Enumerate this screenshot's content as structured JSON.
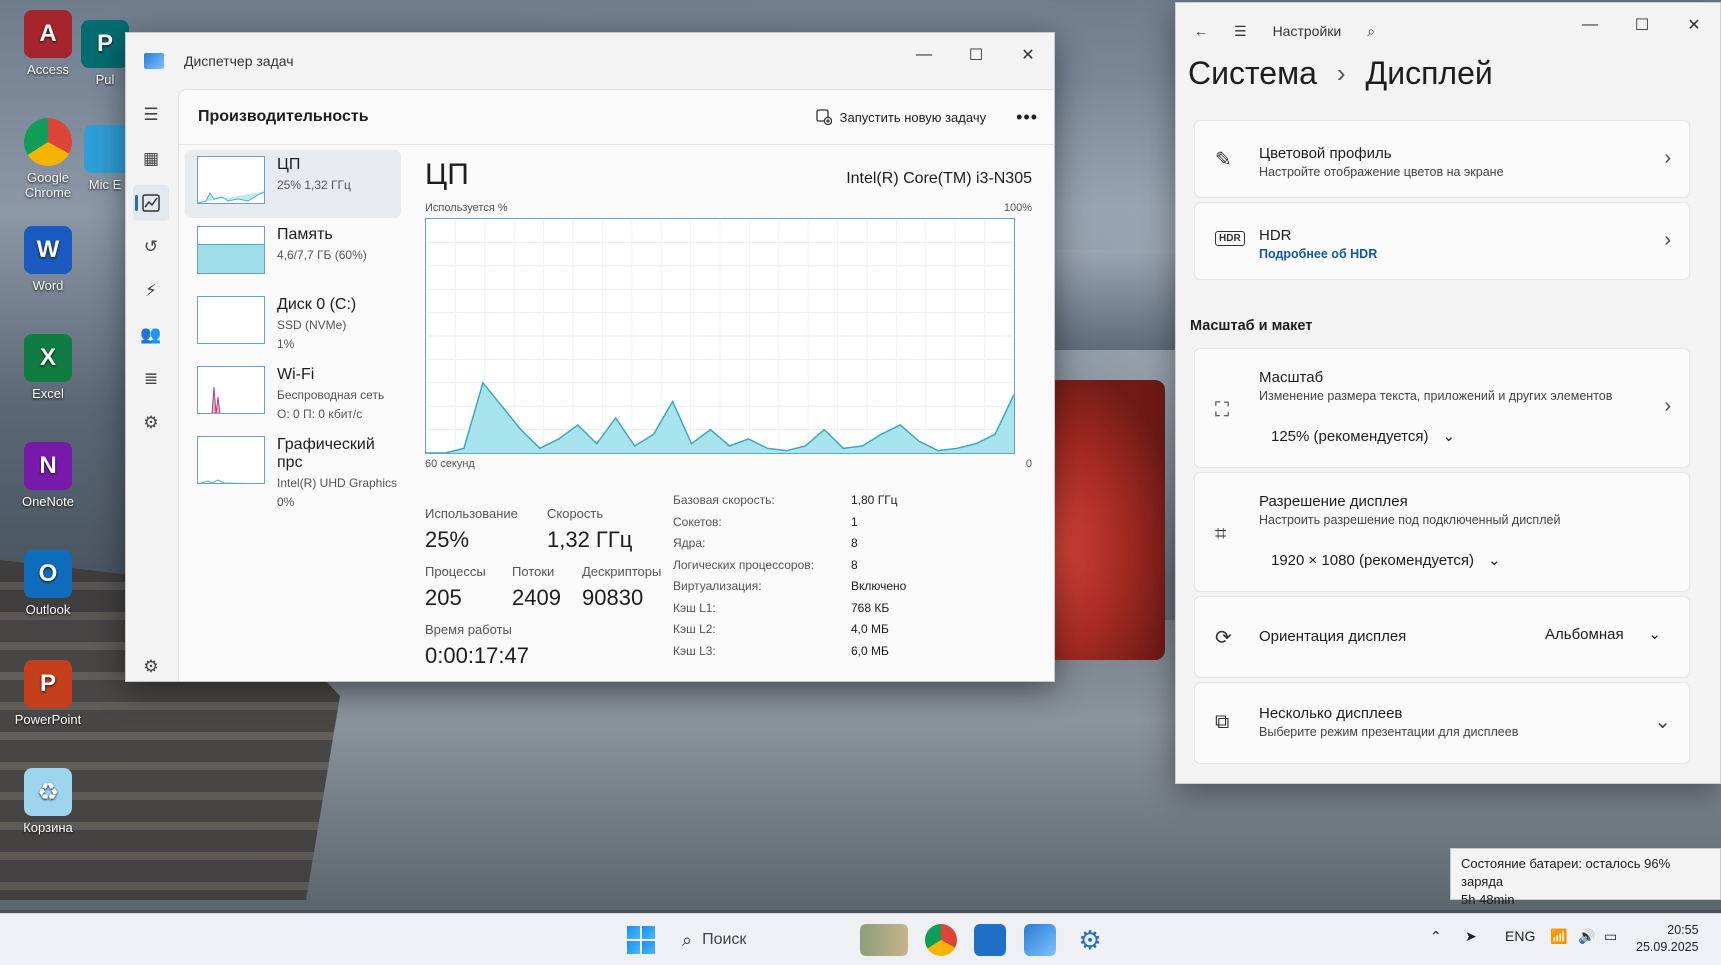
{
  "desktop": {
    "icons": [
      {
        "label": "Access",
        "letter": "A",
        "color": "#a4262c"
      },
      {
        "label": "Google Chrome",
        "letter": "",
        "color": "#ffffff"
      },
      {
        "label": "Word",
        "letter": "W",
        "color": "#185abd"
      },
      {
        "label": "Excel",
        "letter": "X",
        "color": "#107c41"
      },
      {
        "label": "OneNote",
        "letter": "N",
        "color": "#7719aa"
      },
      {
        "label": "Outlook",
        "letter": "O",
        "color": "#0f6cbd"
      },
      {
        "label": "PowerPoint",
        "letter": "P",
        "color": "#c43e1c"
      },
      {
        "label": "Корзина",
        "letter": "♻",
        "color": "#9fd4ef"
      }
    ],
    "partial_icons": [
      {
        "label": "Pul",
        "letter": "P",
        "color": "#036c70"
      },
      {
        "label": "Mic E",
        "letter": "",
        "color": "#2f9fd8"
      }
    ]
  },
  "task_manager": {
    "window_title": "Диспетчер задач",
    "page_title": "Производительность",
    "run_task_label": "Запустить новую задачу",
    "more_label": "•••",
    "perf_items": [
      {
        "name": "ЦП",
        "sub1": "25%  1,32 ГГц",
        "sub2": "",
        "sub3": ""
      },
      {
        "name": "Память",
        "sub1": "4,6/7,7 ГБ (60%)",
        "sub2": "",
        "sub3": ""
      },
      {
        "name": "Диск 0 (C:)",
        "sub1": "SSD (NVMe)",
        "sub2": "1%",
        "sub3": ""
      },
      {
        "name": "Wi-Fi",
        "sub1": "Беспроводная сеть",
        "sub2": "О: 0 П: 0 кбит/с",
        "sub3": ""
      },
      {
        "name": "Графический прс",
        "sub1": "Intel(R) UHD Graphics",
        "sub2": "0%",
        "sub3": ""
      }
    ],
    "detail": {
      "title": "ЦП",
      "model": "Intel(R) Core(TM) i3-N305",
      "usage_label": "Используется %",
      "usage_max": "100%",
      "x_left": "60 секунд",
      "x_right": "0",
      "stats": [
        {
          "label": "Использование",
          "value": "25%"
        },
        {
          "label": "Скорость",
          "value": "1,32 ГГц"
        },
        {
          "label": "Процессы",
          "value": "205"
        },
        {
          "label": "Потоки",
          "value": "2409"
        },
        {
          "label": "Дескрипторы",
          "value": "90830"
        },
        {
          "label": "Время работы",
          "value": "0:00:17:47"
        }
      ],
      "properties": [
        {
          "k": "Базовая скорость:",
          "v": "1,80 ГГц"
        },
        {
          "k": "Сокетов:",
          "v": "1"
        },
        {
          "k": "Ядра:",
          "v": "8"
        },
        {
          "k": "Логических процессоров:",
          "v": "8"
        },
        {
          "k": "Виртуализация:",
          "v": "Включено"
        },
        {
          "k": "Кэш L1:",
          "v": "768 КБ"
        },
        {
          "k": "Кэш L2:",
          "v": "4,0 МБ"
        },
        {
          "k": "Кэш L3:",
          "v": "6,0 МБ"
        }
      ]
    },
    "cpu_history_pct": [
      0,
      0,
      2,
      30,
      20,
      10,
      2,
      6,
      12,
      4,
      15,
      3,
      8,
      22,
      4,
      10,
      3,
      6,
      2,
      1,
      3,
      10,
      2,
      3,
      8,
      12,
      5,
      1,
      2,
      4,
      8,
      25
    ]
  },
  "settings": {
    "app_title": "Настройки",
    "crumb_parent": "Система",
    "crumb_sep": "›",
    "crumb_current": "Дисплей",
    "color_profile": {
      "title": "Цветовой профиль",
      "subtitle": "Настройте отображение цветов на экране"
    },
    "hdr": {
      "title": "HDR",
      "subtitle": "Подробнее об HDR",
      "badge": "HDR"
    },
    "section_scale": "Масштаб и макет",
    "scale": {
      "title": "Масштаб",
      "subtitle": "Изменение размера текста, приложений и других элементов",
      "value": "125% (рекомендуется)"
    },
    "resolution": {
      "title": "Разрешение дисплея",
      "subtitle": "Настроить разрешение под подключенный дисплей",
      "value": "1920 × 1080 (рекомендуется)"
    },
    "orientation": {
      "title": "Ориентация дисплея",
      "value": "Альбомная"
    },
    "multi": {
      "title": "Несколько дисплеев",
      "subtitle": "Выберите режим презентации для дисплеев"
    }
  },
  "battery_tip": {
    "line1": "Состояние батареи: осталось 96% заряда",
    "line2": "5h 48min"
  },
  "taskbar": {
    "search_label": "Поиск",
    "lang": "ENG",
    "time": "20:55",
    "date": "25.09.2025"
  }
}
